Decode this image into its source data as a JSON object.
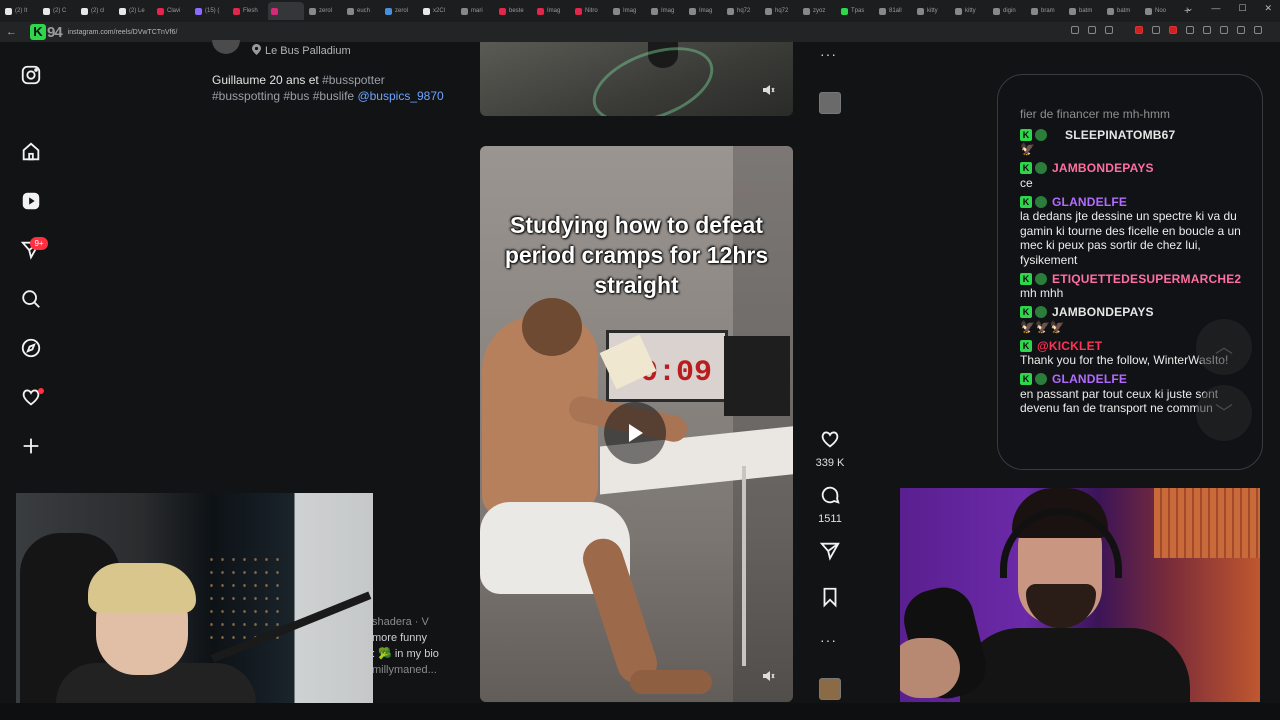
{
  "browser": {
    "tabs": [
      {
        "label": "(2) It",
        "color": "#e8e8e8",
        "active": false
      },
      {
        "label": "(2) C",
        "color": "#e8e8e8",
        "active": false
      },
      {
        "label": "(2) cl",
        "color": "#e8e8e8",
        "active": false
      },
      {
        "label": "(2) Le",
        "color": "#e8e8e8",
        "active": false
      },
      {
        "label": "Clavi",
        "color": "#e2264d",
        "active": false
      },
      {
        "label": "(15) (",
        "color": "#8c6bff",
        "active": false
      },
      {
        "label": "Flesh",
        "color": "#e2264d",
        "active": false
      },
      {
        "label": "",
        "color": "#d62976",
        "active": true
      },
      {
        "label": "zerol",
        "color": "#888888",
        "active": false
      },
      {
        "label": "euch",
        "color": "#888888",
        "active": false
      },
      {
        "label": "zerol",
        "color": "#4a90d9",
        "active": false
      },
      {
        "label": "x2Cl",
        "color": "#e8e8e8",
        "active": false
      },
      {
        "label": "mari",
        "color": "#888888",
        "active": false
      },
      {
        "label": "beste",
        "color": "#e2264d",
        "active": false
      },
      {
        "label": "Imag",
        "color": "#e2264d",
        "active": false
      },
      {
        "label": "Nitro",
        "color": "#e2264d",
        "active": false
      },
      {
        "label": "Imag",
        "color": "#888888",
        "active": false
      },
      {
        "label": "Imag",
        "color": "#888888",
        "active": false
      },
      {
        "label": "Imag",
        "color": "#888888",
        "active": false
      },
      {
        "label": "hq72",
        "color": "#888888",
        "active": false
      },
      {
        "label": "hq72",
        "color": "#888888",
        "active": false
      },
      {
        "label": "zyoz",
        "color": "#888888",
        "active": false
      },
      {
        "label": "Tpas",
        "color": "#2fd64c",
        "active": false
      },
      {
        "label": "81all",
        "color": "#888888",
        "active": false
      },
      {
        "label": "kitty",
        "color": "#888888",
        "active": false
      },
      {
        "label": "kitty",
        "color": "#888888",
        "active": false
      },
      {
        "label": "digin",
        "color": "#888888",
        "active": false
      },
      {
        "label": "bram",
        "color": "#888888",
        "active": false
      },
      {
        "label": "batm",
        "color": "#888888",
        "active": false
      },
      {
        "label": "batm",
        "color": "#888888",
        "active": false
      },
      {
        "label": "Noo",
        "color": "#888888",
        "active": false
      }
    ],
    "new_tab_glyph": "+",
    "window_controls": [
      "⌄",
      "—",
      "☐",
      "✕"
    ],
    "back_glyph": "←",
    "extension_logo_letter": "K",
    "extension_logo_text": "94",
    "url": "instagram.com/reels/DVwTCTnVf6/"
  },
  "post": {
    "location": "Le Bus Palladium",
    "caption_text": "Guillaume 20 ans et ",
    "caption_tag1": "#busspotter",
    "caption_tags": "#busspotting #bus #buslife",
    "caption_mention": "@buspics_9870",
    "notification_badge": "9+"
  },
  "bottom_snippet": {
    "line1": "shadera · V",
    "line2": "more funny",
    "line3": ": 🥦  in my bio",
    "line4": "millymaned..."
  },
  "reel": {
    "overlay_text": "Studying how to defeat period cramps for 12hrs straight",
    "timer_text": "0:09",
    "likes": "339 K",
    "comments": "1511",
    "more_glyph": "···"
  },
  "chat": {
    "previous_line": "fier de financer me mh-hmm",
    "messages": [
      {
        "user": "SLEEPINATOMB67",
        "color": "#e6e6e6",
        "text": "🦅",
        "sub": true
      },
      {
        "user": "JAMBONDEPAYS",
        "color": "#ff6fa0",
        "text": "ce",
        "sub": false
      },
      {
        "user": "GLANDELFE",
        "color": "#b26bff",
        "text": "la dedans jte dessine un spectre ki va du gamin ki tourne des ficelle en boucle a un mec ki peux pas sortir de chez lui, fysikement",
        "sub": false
      },
      {
        "user": "ETIQUETTEDESUPERMARCHE2",
        "color": "#ff6fa0",
        "text": "mh mhh",
        "sub": false
      },
      {
        "user": "JAMBONDEPAYS",
        "color": "#e6e6e6",
        "text": "🦅🦅🦅",
        "sub": false
      },
      {
        "user": "@KICKLET",
        "color": "#ff3355",
        "text": "Thank you for the follow, WinterWasIto!",
        "sub": false,
        "bot": true
      },
      {
        "user": "GLANDELFE",
        "color": "#b26bff",
        "text": "en passant par tout ceux ki juste sont devenu fan de transport ne commun",
        "sub": false
      }
    ],
    "scroll_up_glyph": "︿",
    "scroll_down_glyph": "﹀"
  }
}
